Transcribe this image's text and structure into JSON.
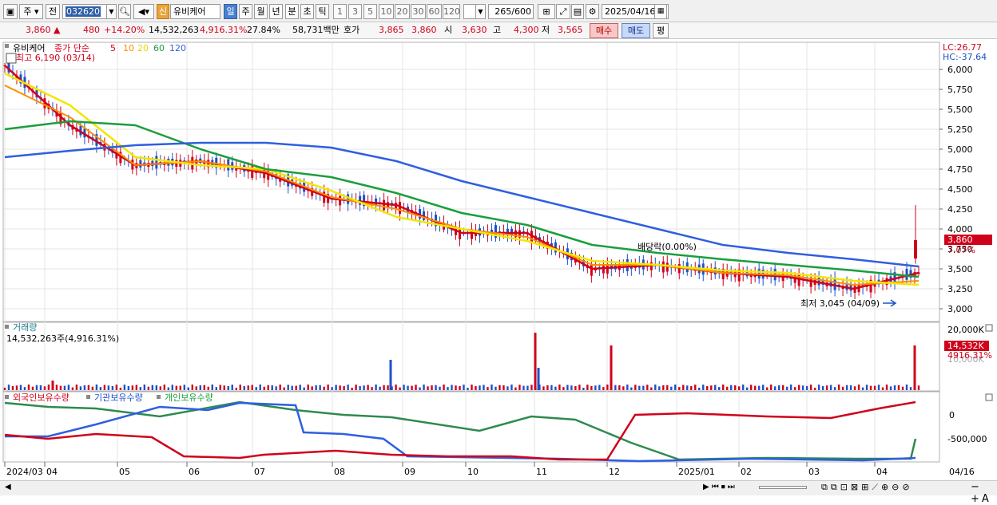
{
  "toolbar": {
    "period_select": "주",
    "prev_label": "전",
    "stock_code": "032620",
    "stock_badge": "신",
    "stock_name": "유비케어",
    "periods": [
      "일",
      "주",
      "월",
      "년",
      "분",
      "초",
      "틱"
    ],
    "intervals": [
      "1",
      "3",
      "5",
      "10",
      "20",
      "30",
      "60",
      "120"
    ],
    "count_value": "265",
    "count_total": "/600",
    "date_value": "2025/04/16"
  },
  "quote": {
    "price": "3,860",
    "change": "480",
    "change_pct": "+14.20%",
    "volume": "14,532,263",
    "volume_ratio": "4,916.31%",
    "turnover": "27.84%",
    "amount": "58,731백만",
    "ask_label": "호가",
    "ask_price": "3,865",
    "bid_price": "3,860",
    "open_label": "시",
    "open_price": "3,630",
    "high_label": "고",
    "high_price": "4,300",
    "low_label": "저",
    "low_price": "3,565",
    "buy_label": "매수",
    "sell_label": "매도",
    "eval_label": "평"
  },
  "price_panel": {
    "legend_name": "유비케어",
    "legend_ma_label": "종가 단순",
    "ma_periods": [
      "5",
      "10",
      "20",
      "60",
      "120"
    ],
    "high_annotation": "최고 6,190 (03/14)",
    "low_annotation": "최저 3,045 (04/09)",
    "dividend_annotation": "배당락(0.00%)",
    "lc_label": "LC:26.77",
    "hc_label": "HC:-37.64",
    "current_price_label": "3,860",
    "current_pct_label": "7.07%",
    "y_ticks": [
      "6,000",
      "5,750",
      "5,500",
      "5,250",
      "5,000",
      "4,750",
      "4,500",
      "4,250",
      "4,000",
      "3,750",
      "3,500",
      "3,250",
      "3,000"
    ]
  },
  "volume_panel": {
    "title": "거래량",
    "value_label": "14,532,263주(4,916.31%)",
    "y_max_label": "20,000K",
    "current_label": "14,532K",
    "current_pct": "4916.31%",
    "faded_label": "10,000K"
  },
  "holdings_panel": {
    "foreign_label": "외국인보유수량",
    "inst_label": "기관보유수량",
    "indiv_label": "개인보유수량",
    "y_ticks": [
      "0",
      "-500,000"
    ]
  },
  "x_axis": {
    "labels": [
      "2024/03",
      "04",
      "05",
      "06",
      "07",
      "08",
      "09",
      "10",
      "11",
      "12",
      "2025/01",
      "02",
      "03",
      "04"
    ],
    "right_label": "04/16"
  },
  "colors": {
    "up": "#d0021b",
    "down": "#1e50c8",
    "ma5": "#d0021b",
    "ma10": "#ff8c00",
    "ma20": "#f2e600",
    "ma60": "#1a9e3c",
    "ma120": "#2f5fe0"
  },
  "chart_data": {
    "type": "line",
    "title": "유비케어",
    "x": [
      "2024/03",
      "04",
      "05",
      "06",
      "07",
      "08",
      "09",
      "10",
      "11",
      "12",
      "2025/01",
      "02",
      "03",
      "04"
    ],
    "ylim": [
      3000,
      6190
    ],
    "series": [
      {
        "name": "5",
        "values": [
          6050,
          5300,
          4800,
          4850,
          4700,
          4380,
          4300,
          3950,
          3950,
          3500,
          3550,
          3450,
          3400,
          3250,
          3450
        ]
      },
      {
        "name": "10",
        "values": [
          5800,
          5400,
          4800,
          4850,
          4720,
          4400,
          4250,
          4000,
          3900,
          3550,
          3550,
          3450,
          3420,
          3300,
          3350
        ]
      },
      {
        "name": "20",
        "values": [
          5950,
          5550,
          4900,
          4800,
          4750,
          4480,
          4150,
          4000,
          3850,
          3600,
          3550,
          3480,
          3450,
          3350,
          3300
        ]
      },
      {
        "name": "60",
        "values": [
          5250,
          5350,
          5300,
          5000,
          4750,
          4650,
          4450,
          4200,
          4050,
          3800,
          3700,
          3620,
          3550,
          3480,
          3400
        ]
      },
      {
        "name": "120",
        "values": [
          4900,
          4980,
          5050,
          5080,
          5080,
          5020,
          4850,
          4600,
          4400,
          4200,
          4000,
          3800,
          3700,
          3620,
          3530
        ]
      }
    ],
    "current_price": 3860,
    "high": {
      "value": 6190,
      "date": "03/14"
    },
    "low": {
      "value": 3045,
      "date": "04/09"
    }
  }
}
